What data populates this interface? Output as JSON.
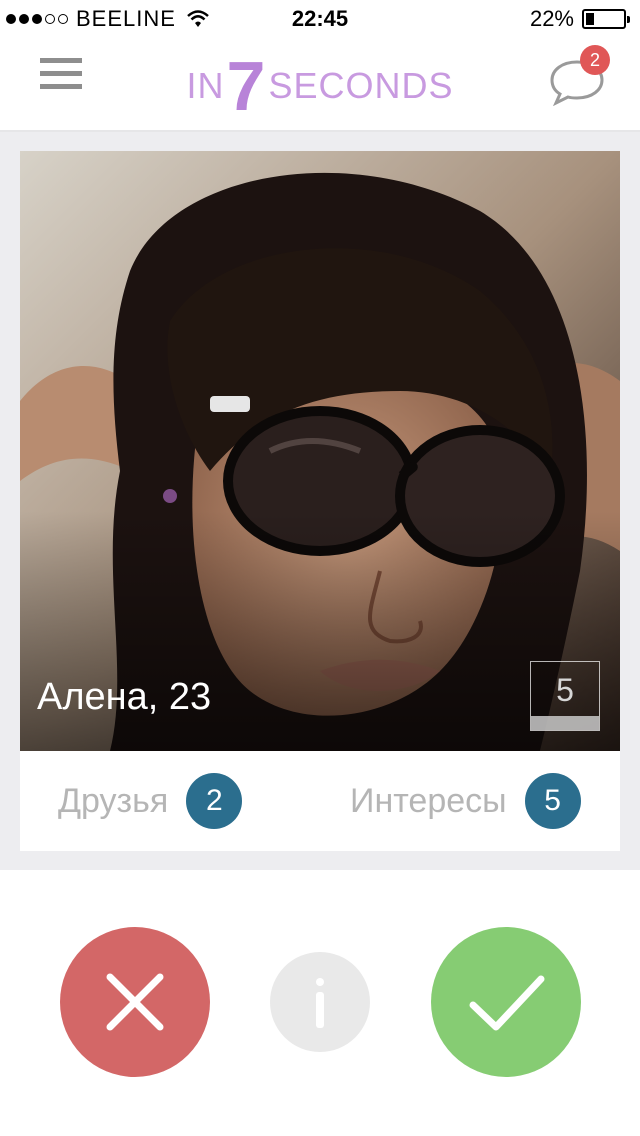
{
  "status_bar": {
    "carrier": "BEELINE",
    "time": "22:45",
    "battery": "22%",
    "battery_level": 0.22,
    "signal_bars": 3
  },
  "nav": {
    "logo_left": "IN",
    "logo_number": "7",
    "logo_right": "SECONDS",
    "messages_badge": "2"
  },
  "profile": {
    "name_age": "Алена, 23",
    "photo_count": "5",
    "friends_label": "Друзья",
    "friends_count": "2",
    "interests_label": "Интересы",
    "interests_count": "5"
  },
  "colors": {
    "logo": "#c89ae0",
    "badge_red": "#e05757",
    "badge_blue": "#2b6e8e",
    "dislike": "#d36767",
    "like": "#86cc73",
    "info": "#e9e9e9"
  },
  "icons": {
    "menu": "hamburger-icon",
    "chat": "chat-bubble-icon",
    "dislike": "close-icon",
    "info": "info-icon",
    "like": "checkmark-icon"
  }
}
